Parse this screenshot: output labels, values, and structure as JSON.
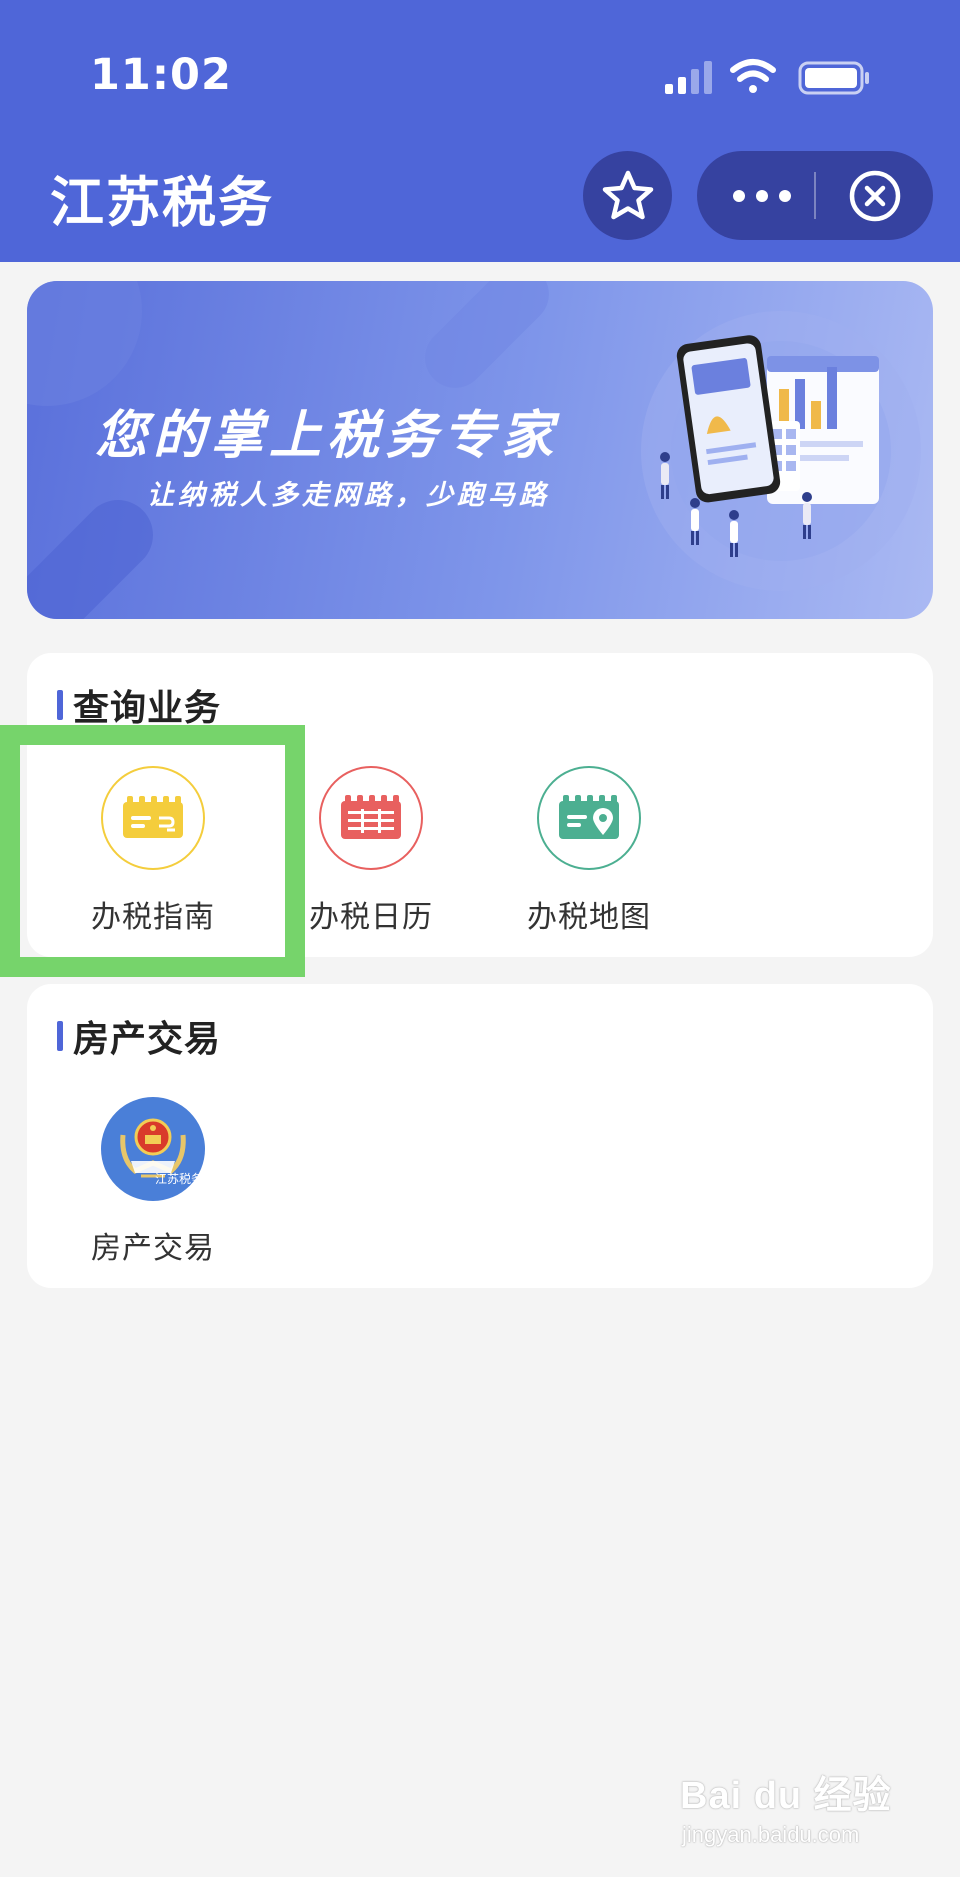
{
  "status_bar": {
    "time": "11:02",
    "icons": [
      "cellular-signal-icon",
      "wifi-icon",
      "battery-icon"
    ]
  },
  "header": {
    "title": "江苏税务",
    "buttons": [
      "star-icon",
      "more-icon",
      "close-icon"
    ]
  },
  "banner": {
    "title": "您的掌上税务专家",
    "subtitle": "让纳税人多走网路，少跑马路"
  },
  "sections": {
    "query": {
      "title": "查询业务",
      "items": [
        {
          "label": "办税指南",
          "icon": "tax-guide-icon",
          "color": "#f4cd3c"
        },
        {
          "label": "办税日历",
          "icon": "tax-calendar-icon",
          "color": "#e8605f"
        },
        {
          "label": "办税地图",
          "icon": "tax-map-icon",
          "color": "#4caf91"
        }
      ]
    },
    "house": {
      "title": "房产交易",
      "items": [
        {
          "label": "房产交易",
          "icon": "tax-bureau-emblem-icon",
          "color": "#4a7fd8",
          "emblem_text": "江苏税务"
        }
      ]
    }
  },
  "watermark": {
    "main": "Bai du 经验",
    "url": "jingyan.baidu.com"
  },
  "colors": {
    "header_bg": "#4f66d8",
    "button_bg": "#3642a0",
    "highlight": "#76d46b",
    "page_bg": "#f4f4f4"
  }
}
